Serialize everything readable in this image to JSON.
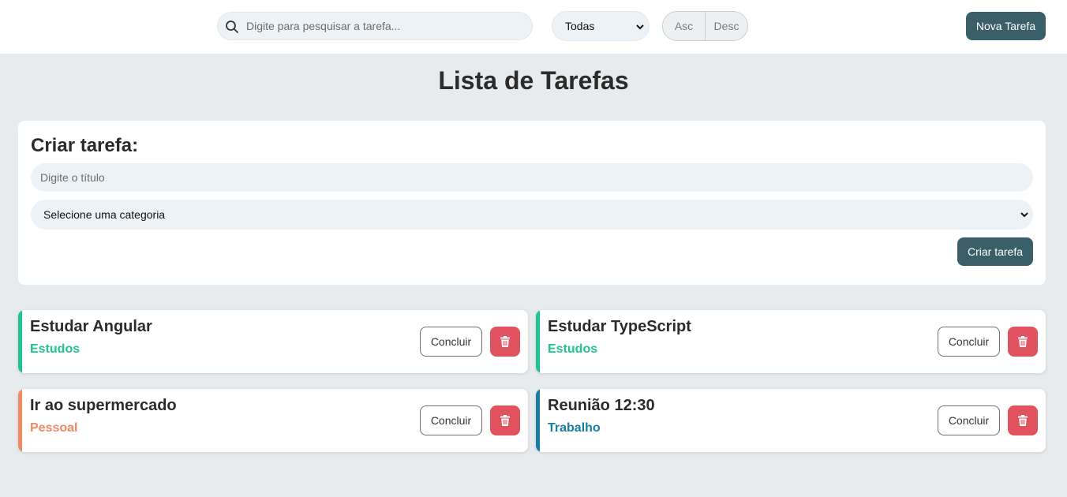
{
  "header": {
    "search": {
      "placeholder": "Digite para pesquisar a tarefa...",
      "icon": "search-icon"
    },
    "filter": {
      "selected": "Todas",
      "icon": "chevron-down-icon"
    },
    "sort": {
      "asc_label": "Asc",
      "desc_label": "Desc"
    },
    "new_task_label": "Nova Tarefa"
  },
  "page_title": "Lista de Tarefas",
  "create_form": {
    "title": "Criar tarefa:",
    "title_placeholder": "Digite o título",
    "category_selected": "Selecione uma categoria",
    "submit_label": "Criar tarefa"
  },
  "tasks": [
    {
      "title": "Estudar Angular",
      "category": "Estudos",
      "color": "#1fc38e",
      "done_label": "Concluir",
      "delete_icon": "trash-icon"
    },
    {
      "title": "Estudar TypeScript",
      "category": "Estudos",
      "color": "#1fc38e",
      "done_label": "Concluir",
      "delete_icon": "trash-icon"
    },
    {
      "title": "Ir ao supermercado",
      "category": "Pessoal",
      "color": "#ee8a64",
      "done_label": "Concluir",
      "delete_icon": "trash-icon"
    },
    {
      "title": "Reunião 12:30",
      "category": "Trabalho",
      "color": "#167fa1",
      "done_label": "Concluir",
      "delete_icon": "trash-icon"
    }
  ],
  "colors": {
    "primary": "#3a5f6b",
    "danger": "#e0525e",
    "background": "#e7ebee"
  }
}
